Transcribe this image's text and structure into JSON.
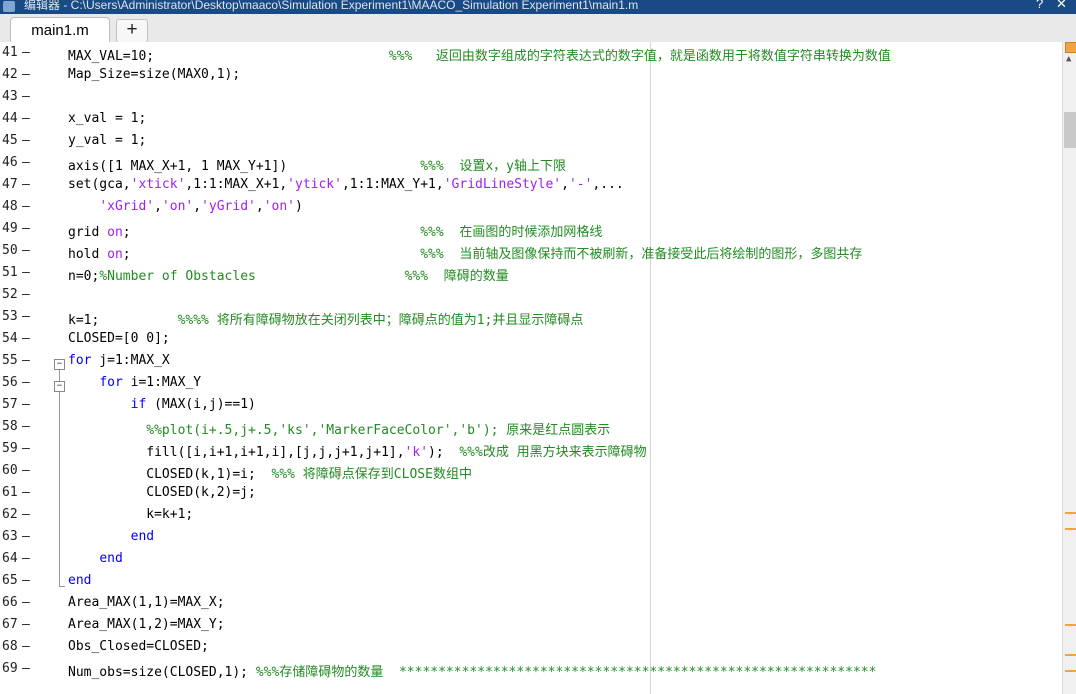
{
  "window": {
    "title": "编辑器 - C:\\Users\\Administrator\\Desktop\\maaco\\Simulation Experiment1\\MAACO_Simulation Experiment1\\main1.m"
  },
  "tabs": [
    {
      "label": "main1.m",
      "active": true
    }
  ],
  "new_tab_label": "+",
  "editor": {
    "lines": [
      {
        "num": "41",
        "code": [
          {
            "t": "MAX_VAL=10;                              ",
            "c": ""
          },
          {
            "t": "%%%   返回由数字组成的字符表达式的数字值，就是函数用于将数值字符串转换为数值",
            "c": "cmt"
          }
        ]
      },
      {
        "num": "42",
        "code": [
          {
            "t": "Map_Size=size(MAX0,1);",
            "c": ""
          }
        ]
      },
      {
        "num": "43",
        "code": []
      },
      {
        "num": "44",
        "code": [
          {
            "t": "x_val = 1;",
            "c": ""
          }
        ]
      },
      {
        "num": "45",
        "code": [
          {
            "t": "y_val = 1;",
            "c": ""
          }
        ]
      },
      {
        "num": "46",
        "code": [
          {
            "t": "axis([1 MAX_X+1, 1 MAX_Y+1])                 ",
            "c": ""
          },
          {
            "t": "%%%  设置x，y轴上下限",
            "c": "cmt"
          }
        ]
      },
      {
        "num": "47",
        "code": [
          {
            "t": "set(gca,",
            "c": ""
          },
          {
            "t": "'xtick'",
            "c": "str"
          },
          {
            "t": ",1:1:MAX_X+1,",
            "c": ""
          },
          {
            "t": "'ytick'",
            "c": "str"
          },
          {
            "t": ",1:1:MAX_Y+1,",
            "c": ""
          },
          {
            "t": "'GridLineStyle'",
            "c": "str"
          },
          {
            "t": ",",
            "c": ""
          },
          {
            "t": "'-'",
            "c": "str"
          },
          {
            "t": ",...",
            "c": ""
          }
        ]
      },
      {
        "num": "48",
        "code": [
          {
            "t": "    ",
            "c": ""
          },
          {
            "t": "'xGrid'",
            "c": "str"
          },
          {
            "t": ",",
            "c": ""
          },
          {
            "t": "'on'",
            "c": "str"
          },
          {
            "t": ",",
            "c": ""
          },
          {
            "t": "'yGrid'",
            "c": "str"
          },
          {
            "t": ",",
            "c": ""
          },
          {
            "t": "'on'",
            "c": "str"
          },
          {
            "t": ")",
            "c": ""
          }
        ]
      },
      {
        "num": "49",
        "code": [
          {
            "t": "grid ",
            "c": ""
          },
          {
            "t": "on",
            "c": "str"
          },
          {
            "t": ";                                     ",
            "c": ""
          },
          {
            "t": "%%%  在画图的时候添加网格线",
            "c": "cmt"
          }
        ]
      },
      {
        "num": "50",
        "code": [
          {
            "t": "hold ",
            "c": ""
          },
          {
            "t": "on",
            "c": "str"
          },
          {
            "t": ";                                     ",
            "c": ""
          },
          {
            "t": "%%%  当前轴及图像保持而不被刷新，准备接受此后将绘制的图形，多图共存",
            "c": "cmt"
          }
        ]
      },
      {
        "num": "51",
        "code": [
          {
            "t": "n=0;",
            "c": ""
          },
          {
            "t": "%Number of Obstacles",
            "c": "cmt"
          },
          {
            "t": "                   ",
            "c": ""
          },
          {
            "t": "%%%  障碍的数量",
            "c": "cmt"
          }
        ]
      },
      {
        "num": "52",
        "code": []
      },
      {
        "num": "53",
        "code": [
          {
            "t": "k=1;          ",
            "c": ""
          },
          {
            "t": "%%%% 将所有障碍物放在关闭列表中；障碍点的值为1;并且显示障碍点",
            "c": "cmt"
          }
        ]
      },
      {
        "num": "54",
        "code": [
          {
            "t": "CLOSED=[0 0];",
            "c": ""
          }
        ]
      },
      {
        "num": "55",
        "code": [
          {
            "t": "for",
            "c": "kw"
          },
          {
            "t": " j=1:MAX_X",
            "c": ""
          }
        ]
      },
      {
        "num": "56",
        "code": [
          {
            "t": "    ",
            "c": ""
          },
          {
            "t": "for",
            "c": "kw"
          },
          {
            "t": " i=1:MAX_Y",
            "c": ""
          }
        ]
      },
      {
        "num": "57",
        "code": [
          {
            "t": "        ",
            "c": ""
          },
          {
            "t": "if",
            "c": "kw"
          },
          {
            "t": " (MAX(i,j)==1)",
            "c": ""
          }
        ]
      },
      {
        "num": "58",
        "code": [
          {
            "t": "          ",
            "c": ""
          },
          {
            "t": "%%plot(i+.5,j+.5,'ks','MarkerFaceColor','b'); 原来是红点圆表示",
            "c": "cmt"
          }
        ]
      },
      {
        "num": "59",
        "code": [
          {
            "t": "          fill([i,i+1,i+1,i],[j,j,j+1,j+1],",
            "c": ""
          },
          {
            "t": "'k'",
            "c": "str"
          },
          {
            "t": ");  ",
            "c": ""
          },
          {
            "t": "%%%改成 用黑方块来表示障碍物",
            "c": "cmt"
          }
        ]
      },
      {
        "num": "60",
        "code": [
          {
            "t": "          CLOSED(k,1)=i;  ",
            "c": ""
          },
          {
            "t": "%%% 将障碍点保存到CLOSE数组中",
            "c": "cmt"
          }
        ]
      },
      {
        "num": "61",
        "code": [
          {
            "t": "          CLOSED(k,2)=j;",
            "c": ""
          }
        ]
      },
      {
        "num": "62",
        "code": [
          {
            "t": "          k=k+1;",
            "c": ""
          }
        ]
      },
      {
        "num": "63",
        "code": [
          {
            "t": "        ",
            "c": ""
          },
          {
            "t": "end",
            "c": "kw"
          }
        ]
      },
      {
        "num": "64",
        "code": [
          {
            "t": "    ",
            "c": ""
          },
          {
            "t": "end",
            "c": "kw"
          }
        ]
      },
      {
        "num": "65",
        "code": [
          {
            "t": "end",
            "c": "kw"
          }
        ]
      },
      {
        "num": "66",
        "code": [
          {
            "t": "Area_MAX(1,1)=MAX_X;",
            "c": ""
          }
        ]
      },
      {
        "num": "67",
        "code": [
          {
            "t": "Area_MAX(1,2)=MAX_Y;",
            "c": ""
          }
        ]
      },
      {
        "num": "68",
        "code": [
          {
            "t": "Obs_Closed=CLOSED;",
            "c": ""
          }
        ]
      },
      {
        "num": "69",
        "code": [
          {
            "t": "Num_obs=size(CLOSED,1); ",
            "c": ""
          },
          {
            "t": "%%%存储障碍物的数量  *************************************************************",
            "c": "cmt"
          }
        ]
      }
    ]
  },
  "colors": {
    "keyword": "#0000ff",
    "string": "#a020f0",
    "comment": "#228b22",
    "title_bar": "#1a4a86",
    "scroll_marker": "#f4a341"
  }
}
